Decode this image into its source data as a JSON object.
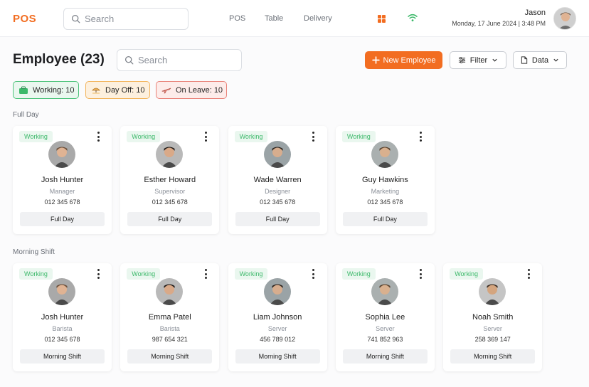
{
  "header": {
    "logo": "POS",
    "search_placeholder": "Search",
    "nav": [
      "POS",
      "Table",
      "Delivery"
    ],
    "user_name": "Jason",
    "date": "Monday, 17 June 2024 | 3:48 PM"
  },
  "page": {
    "title": "Employee (23)",
    "search_placeholder": "Search",
    "new_button": "New Employee",
    "filter_button": "Filter",
    "data_button": "Data"
  },
  "chips": {
    "working": "Working: 10",
    "dayoff": "Day Off: 10",
    "leave": "On Leave: 10"
  },
  "sections": {
    "full_day": {
      "label": "Full Day",
      "cards": [
        {
          "status": "Working",
          "name": "Josh Hunter",
          "role": "Manager",
          "phone": "012 345 678",
          "shift": "Full Day"
        },
        {
          "status": "Working",
          "name": "Esther Howard",
          "role": "Supervisor",
          "phone": "012 345 678",
          "shift": "Full Day"
        },
        {
          "status": "Working",
          "name": "Wade Warren",
          "role": "Designer",
          "phone": "012 345 678",
          "shift": "Full Day"
        },
        {
          "status": "Working",
          "name": "Guy Hawkins",
          "role": "Marketing",
          "phone": "012 345 678",
          "shift": "Full Day"
        }
      ]
    },
    "morning": {
      "label": "Morning Shift",
      "cards": [
        {
          "status": "Working",
          "name": "Josh Hunter",
          "role": "Barista",
          "phone": "012 345 678",
          "shift": "Morning Shift"
        },
        {
          "status": "Working",
          "name": "Emma Patel",
          "role": "Barista",
          "phone": "987 654 321",
          "shift": "Morning Shift"
        },
        {
          "status": "Working",
          "name": "Liam Johnson",
          "role": "Server",
          "phone": "456 789 012",
          "shift": "Morning Shift"
        },
        {
          "status": "Working",
          "name": "Sophia Lee",
          "role": "Server",
          "phone": "741 852 963",
          "shift": "Morning Shift"
        },
        {
          "status": "Working",
          "name": "Noah Smith",
          "role": "Server",
          "phone": "258 369 147",
          "shift": "Morning Shift"
        }
      ]
    }
  },
  "colors": {
    "accent": "#f26d21",
    "working": "#3cb96a",
    "dayoff": "#f2b45c",
    "leave": "#e9837a"
  }
}
